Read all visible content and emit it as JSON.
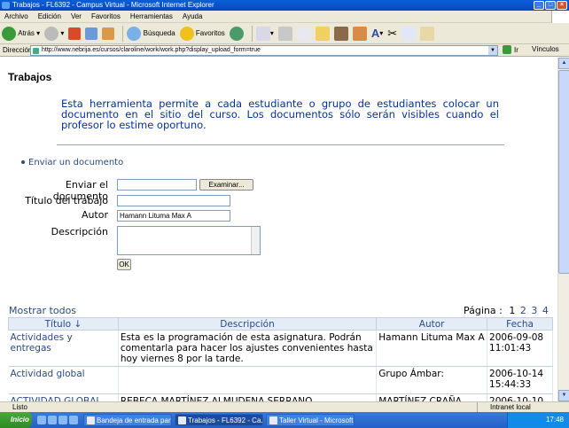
{
  "window": {
    "title": "Trabajos - FL6392 - Campus Virtual - Microsoft Internet Explorer"
  },
  "menu": [
    "Archivo",
    "Edición",
    "Ver",
    "Favoritos",
    "Herramientas",
    "Ayuda"
  ],
  "toolbar": {
    "back": "Atrás",
    "search": "Búsqueda",
    "favorites": "Favoritos"
  },
  "address": {
    "label": "Dirección",
    "url": "http://www.nebrija.es/cursos/claroline/work/work.php?display_upload_form=true",
    "go": "Ir",
    "links": "Vínculos"
  },
  "page": {
    "title": "Trabajos",
    "intro": "Esta herramienta permite a cada estudiante o grupo de estudiantes colocar un documento en el sitio del curso. Los documentos sólo serán visibles cuando el profesor lo estime oportuno.",
    "nav_link": "Enviar un documento"
  },
  "form": {
    "doc_label": "Enviar el documento",
    "browse": "Examinar...",
    "title_label": "Título del trabajo",
    "author_label": "Autor",
    "author_value": "Hamann Lituma Max A",
    "desc_label": "Descripción",
    "ok": "OK"
  },
  "list": {
    "show_all": "Mostrar todos",
    "page_label": "Página :",
    "pages": [
      "1",
      "2",
      "3",
      "4",
      "»"
    ],
    "headers": [
      "Título ↓",
      "Descripción",
      "Autor",
      "Fecha"
    ],
    "rows": [
      {
        "title": "Actividades y entregas",
        "desc": "Esta es la programación de esta asignatura. Podrán comentarla para hacer los ajustes convenientes hasta hoy viernes 8 por la tarde.",
        "author": "Hamann Lituma Max A",
        "date": "2006-09-08 11:01:43"
      },
      {
        "title": "Actividad global",
        "desc": "",
        "author": "Grupo Ámbar:",
        "date": "2006-10-14 15:44:33"
      },
      {
        "title": "ACTIVIDAD GLOBAL",
        "desc": "REBECA MARTÍNEZ ALMUDENA SERRANO",
        "author": "MARTÍNEZ CRAÑA",
        "date": "2006-10-10"
      }
    ]
  },
  "status": {
    "left": "Listo",
    "zone": "Intranet local"
  },
  "taskbar": {
    "start": "Inicio",
    "tasks": [
      "Bandeja de entrada para ...",
      "Trabajos - FL6392 - Ca...",
      "Taller Virtual - Microsoft ..."
    ],
    "clock": "17:48"
  }
}
